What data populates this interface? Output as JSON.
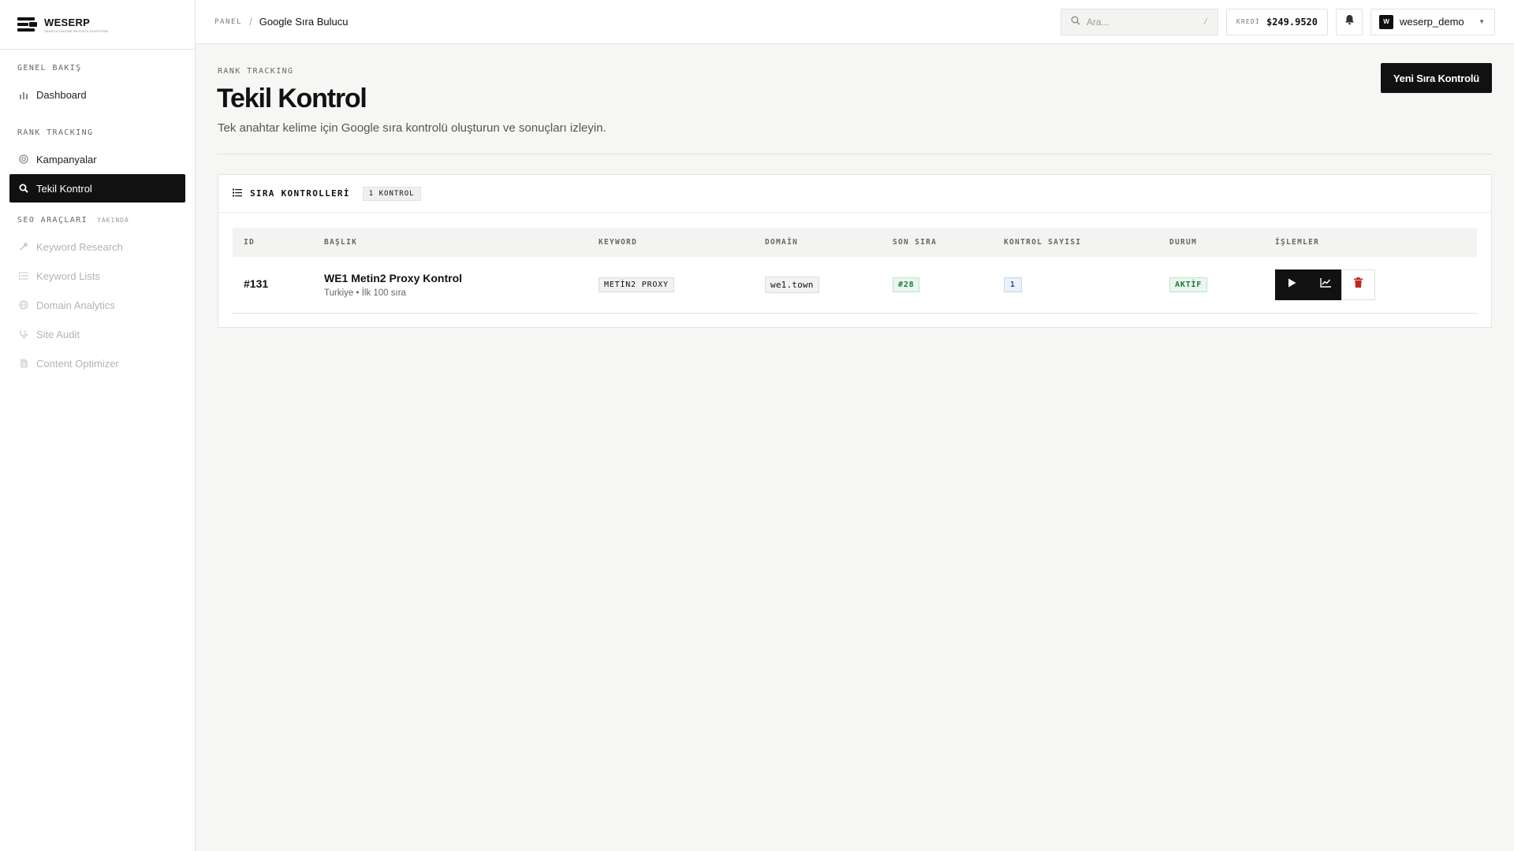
{
  "app": {
    "name": "WESERP",
    "tagline": "SEARCH ENGINE RESULTS PLATFORM"
  },
  "sidebar": {
    "sections": [
      {
        "label": "GENEL BAKIŞ"
      },
      {
        "label": "RANK TRACKING"
      },
      {
        "label": "SEO ARAÇLARI",
        "badge": "YAKINDA"
      }
    ],
    "items": [
      {
        "label": "Dashboard",
        "icon": "bar-chart-icon"
      },
      {
        "label": "Kampanyalar",
        "icon": "target-icon"
      },
      {
        "label": "Tekil Kontrol",
        "icon": "search-icon",
        "active": true
      },
      {
        "label": "Keyword Research",
        "icon": "key-icon",
        "disabled": true
      },
      {
        "label": "Keyword Lists",
        "icon": "list-icon",
        "disabled": true
      },
      {
        "label": "Domain Analytics",
        "icon": "globe-icon",
        "disabled": true
      },
      {
        "label": "Site Audit",
        "icon": "stethoscope-icon",
        "disabled": true
      },
      {
        "label": "Content Optimizer",
        "icon": "document-icon",
        "disabled": true
      }
    ]
  },
  "topbar": {
    "breadcrumb_root": "PANEL",
    "breadcrumb_current": "Google Sıra Bulucu",
    "search_placeholder": "Ara...",
    "search_shortcut": "/",
    "credit_label": "KREDİ",
    "credit_value": "$249.9520",
    "username": "weserp_demo",
    "avatar_initial": "W"
  },
  "page": {
    "eyebrow": "RANK TRACKING",
    "title": "Tekil Kontrol",
    "description": "Tek anahtar kelime için Google sıra kontrolü oluşturun ve sonuçları izleyin.",
    "primary_button": "Yeni Sıra Kontrolü"
  },
  "table_card": {
    "title": "SIRA KONTROLLERİ",
    "count_badge": "1 KONTROL",
    "columns": [
      "ID",
      "BAŞLIK",
      "KEYWORD",
      "DOMAİN",
      "SON SIRA",
      "KONTROL SAYISI",
      "DURUM",
      "İŞLEMLER"
    ],
    "rows": [
      {
        "id": "#131",
        "title": "WE1 Metin2 Proxy Kontrol",
        "subtitle": "Turkiye • İlk 100 sıra",
        "keyword": "METİN2 PROXY",
        "domain": "we1.town",
        "last_rank": "#28",
        "check_count": "1",
        "status": "AKTİF"
      }
    ]
  },
  "colors": {
    "accent": "#111111",
    "status_green": "#1a7a3e",
    "count_blue": "#1f55a5",
    "danger_red": "#c0261f",
    "background": "#f6f6f4"
  }
}
